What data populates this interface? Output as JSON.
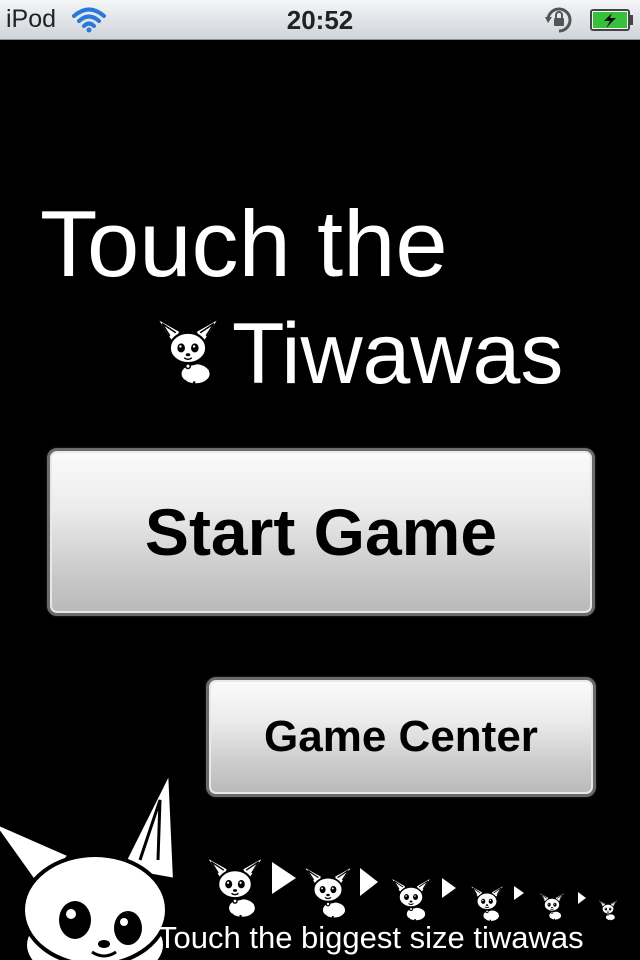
{
  "status_bar": {
    "device": "iPod",
    "time": "20:52",
    "icons": [
      "wifi-icon",
      "rotation-lock-icon",
      "battery-charging-icon"
    ]
  },
  "title": {
    "line1": "Touch the",
    "line2": "Tiwawas"
  },
  "buttons": {
    "start": "Start Game",
    "game_center": "Game Center"
  },
  "hint": {
    "text": "Touch the biggest size tiwawas"
  },
  "colors": {
    "background": "#000000",
    "text": "#ffffff",
    "button_text": "#000000"
  }
}
